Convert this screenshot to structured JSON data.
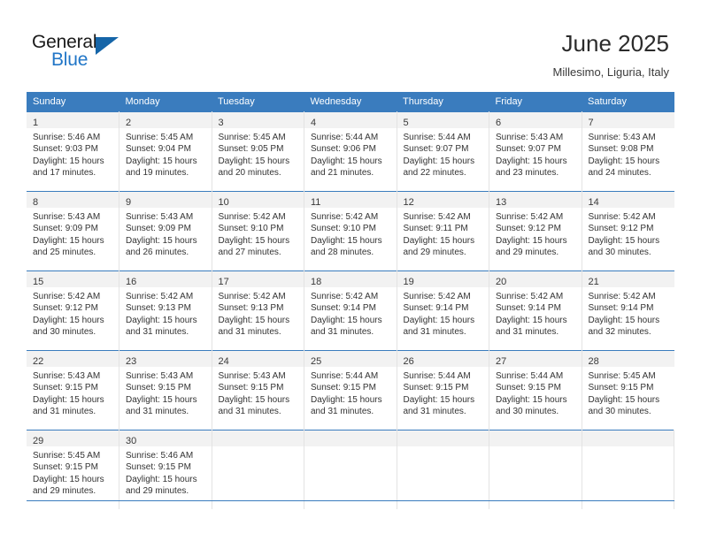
{
  "brand": {
    "name_part1": "General",
    "name_part2": "Blue",
    "logo_icon": "triangle-logo-icon",
    "accent_color": "#2176c7",
    "triangle_color": "#1565a8"
  },
  "header": {
    "title": "June 2025",
    "subtitle": "Millesimo, Liguria, Italy"
  },
  "calendar": {
    "header_bg": "#3a7cbe",
    "daynum_bg": "#f2f2f2",
    "weekday_headers": [
      "Sunday",
      "Monday",
      "Tuesday",
      "Wednesday",
      "Thursday",
      "Friday",
      "Saturday"
    ],
    "weeks": [
      [
        {
          "day": "1",
          "sunrise": "Sunrise: 5:46 AM",
          "sunset": "Sunset: 9:03 PM",
          "daylight": "Daylight: 15 hours and 17 minutes."
        },
        {
          "day": "2",
          "sunrise": "Sunrise: 5:45 AM",
          "sunset": "Sunset: 9:04 PM",
          "daylight": "Daylight: 15 hours and 19 minutes."
        },
        {
          "day": "3",
          "sunrise": "Sunrise: 5:45 AM",
          "sunset": "Sunset: 9:05 PM",
          "daylight": "Daylight: 15 hours and 20 minutes."
        },
        {
          "day": "4",
          "sunrise": "Sunrise: 5:44 AM",
          "sunset": "Sunset: 9:06 PM",
          "daylight": "Daylight: 15 hours and 21 minutes."
        },
        {
          "day": "5",
          "sunrise": "Sunrise: 5:44 AM",
          "sunset": "Sunset: 9:07 PM",
          "daylight": "Daylight: 15 hours and 22 minutes."
        },
        {
          "day": "6",
          "sunrise": "Sunrise: 5:43 AM",
          "sunset": "Sunset: 9:07 PM",
          "daylight": "Daylight: 15 hours and 23 minutes."
        },
        {
          "day": "7",
          "sunrise": "Sunrise: 5:43 AM",
          "sunset": "Sunset: 9:08 PM",
          "daylight": "Daylight: 15 hours and 24 minutes."
        }
      ],
      [
        {
          "day": "8",
          "sunrise": "Sunrise: 5:43 AM",
          "sunset": "Sunset: 9:09 PM",
          "daylight": "Daylight: 15 hours and 25 minutes."
        },
        {
          "day": "9",
          "sunrise": "Sunrise: 5:43 AM",
          "sunset": "Sunset: 9:09 PM",
          "daylight": "Daylight: 15 hours and 26 minutes."
        },
        {
          "day": "10",
          "sunrise": "Sunrise: 5:42 AM",
          "sunset": "Sunset: 9:10 PM",
          "daylight": "Daylight: 15 hours and 27 minutes."
        },
        {
          "day": "11",
          "sunrise": "Sunrise: 5:42 AM",
          "sunset": "Sunset: 9:10 PM",
          "daylight": "Daylight: 15 hours and 28 minutes."
        },
        {
          "day": "12",
          "sunrise": "Sunrise: 5:42 AM",
          "sunset": "Sunset: 9:11 PM",
          "daylight": "Daylight: 15 hours and 29 minutes."
        },
        {
          "day": "13",
          "sunrise": "Sunrise: 5:42 AM",
          "sunset": "Sunset: 9:12 PM",
          "daylight": "Daylight: 15 hours and 29 minutes."
        },
        {
          "day": "14",
          "sunrise": "Sunrise: 5:42 AM",
          "sunset": "Sunset: 9:12 PM",
          "daylight": "Daylight: 15 hours and 30 minutes."
        }
      ],
      [
        {
          "day": "15",
          "sunrise": "Sunrise: 5:42 AM",
          "sunset": "Sunset: 9:12 PM",
          "daylight": "Daylight: 15 hours and 30 minutes."
        },
        {
          "day": "16",
          "sunrise": "Sunrise: 5:42 AM",
          "sunset": "Sunset: 9:13 PM",
          "daylight": "Daylight: 15 hours and 31 minutes."
        },
        {
          "day": "17",
          "sunrise": "Sunrise: 5:42 AM",
          "sunset": "Sunset: 9:13 PM",
          "daylight": "Daylight: 15 hours and 31 minutes."
        },
        {
          "day": "18",
          "sunrise": "Sunrise: 5:42 AM",
          "sunset": "Sunset: 9:14 PM",
          "daylight": "Daylight: 15 hours and 31 minutes."
        },
        {
          "day": "19",
          "sunrise": "Sunrise: 5:42 AM",
          "sunset": "Sunset: 9:14 PM",
          "daylight": "Daylight: 15 hours and 31 minutes."
        },
        {
          "day": "20",
          "sunrise": "Sunrise: 5:42 AM",
          "sunset": "Sunset: 9:14 PM",
          "daylight": "Daylight: 15 hours and 31 minutes."
        },
        {
          "day": "21",
          "sunrise": "Sunrise: 5:42 AM",
          "sunset": "Sunset: 9:14 PM",
          "daylight": "Daylight: 15 hours and 32 minutes."
        }
      ],
      [
        {
          "day": "22",
          "sunrise": "Sunrise: 5:43 AM",
          "sunset": "Sunset: 9:15 PM",
          "daylight": "Daylight: 15 hours and 31 minutes."
        },
        {
          "day": "23",
          "sunrise": "Sunrise: 5:43 AM",
          "sunset": "Sunset: 9:15 PM",
          "daylight": "Daylight: 15 hours and 31 minutes."
        },
        {
          "day": "24",
          "sunrise": "Sunrise: 5:43 AM",
          "sunset": "Sunset: 9:15 PM",
          "daylight": "Daylight: 15 hours and 31 minutes."
        },
        {
          "day": "25",
          "sunrise": "Sunrise: 5:44 AM",
          "sunset": "Sunset: 9:15 PM",
          "daylight": "Daylight: 15 hours and 31 minutes."
        },
        {
          "day": "26",
          "sunrise": "Sunrise: 5:44 AM",
          "sunset": "Sunset: 9:15 PM",
          "daylight": "Daylight: 15 hours and 31 minutes."
        },
        {
          "day": "27",
          "sunrise": "Sunrise: 5:44 AM",
          "sunset": "Sunset: 9:15 PM",
          "daylight": "Daylight: 15 hours and 30 minutes."
        },
        {
          "day": "28",
          "sunrise": "Sunrise: 5:45 AM",
          "sunset": "Sunset: 9:15 PM",
          "daylight": "Daylight: 15 hours and 30 minutes."
        }
      ],
      [
        {
          "day": "29",
          "sunrise": "Sunrise: 5:45 AM",
          "sunset": "Sunset: 9:15 PM",
          "daylight": "Daylight: 15 hours and 29 minutes."
        },
        {
          "day": "30",
          "sunrise": "Sunrise: 5:46 AM",
          "sunset": "Sunset: 9:15 PM",
          "daylight": "Daylight: 15 hours and 29 minutes."
        },
        {
          "day": "",
          "sunrise": "",
          "sunset": "",
          "daylight": ""
        },
        {
          "day": "",
          "sunrise": "",
          "sunset": "",
          "daylight": ""
        },
        {
          "day": "",
          "sunrise": "",
          "sunset": "",
          "daylight": ""
        },
        {
          "day": "",
          "sunrise": "",
          "sunset": "",
          "daylight": ""
        },
        {
          "day": "",
          "sunrise": "",
          "sunset": "",
          "daylight": ""
        }
      ]
    ]
  }
}
